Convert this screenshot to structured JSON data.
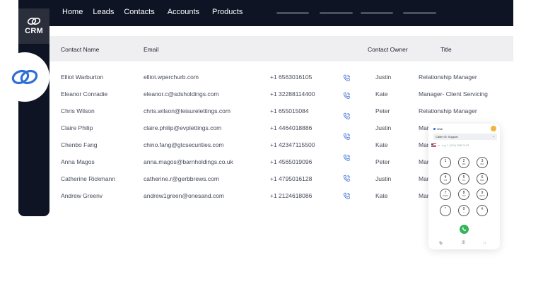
{
  "brand": {
    "label": "CRM"
  },
  "nav": {
    "items": [
      "Home",
      "Leads",
      "Contacts",
      "Accounts",
      "Products"
    ]
  },
  "table": {
    "headers": {
      "name": "Contact Name",
      "email": "Email",
      "owner": "Contact Owner",
      "title": "Title"
    },
    "rows": [
      {
        "name": "Elliot Warburton",
        "email": "elliot.wperchurb.com",
        "phone": "+1 6563016105",
        "owner": "Justin",
        "title": "Relationship Manager"
      },
      {
        "name": "Eleanor Conradie",
        "email": "eleanor.c@sdsholdings.com",
        "phone": "+1 32288114400",
        "owner": "Kate",
        "title": "Manager- Client Servicing"
      },
      {
        "name": "Chris Wilson",
        "email": "chris.wilson@leisurelettings.com",
        "phone": "+1 655015084",
        "owner": "Peter",
        "title": "Relationship Manager"
      },
      {
        "name": "Claire Philip",
        "email": "claire.philip@evplettings.com",
        "phone": "+1 4464018886",
        "owner": "Justin",
        "title": "Man"
      },
      {
        "name": "Chenbo Fang",
        "email": "chino.fang@gtcsecurities.com",
        "phone": "+1 42347115500",
        "owner": "Kate",
        "title": "Man"
      },
      {
        "name": "Anna Magos",
        "email": "anna.magos@barnholdings.co.uk",
        "phone": "+1 4565019096",
        "owner": "Peter",
        "title": "Man"
      },
      {
        "name": "Catherine Rickmann",
        "email": "catherine.r@gerbbrews.com",
        "phone": "+1 4795016128",
        "owner": "Justin",
        "title": "Man"
      },
      {
        "name": "Andrew Greenv",
        "email": "andrew1green@onesand.com",
        "phone": "+1 2124618086",
        "owner": "Kate",
        "title": "Man"
      }
    ]
  },
  "dialer": {
    "brand": "Web",
    "caller_id": "Caller ID: Support",
    "placeholder": "e.g. 1 (201) 555-0123",
    "keys": [
      {
        "num": "1",
        "letters": ""
      },
      {
        "num": "2",
        "letters": "ABC"
      },
      {
        "num": "3",
        "letters": "DEF"
      },
      {
        "num": "4",
        "letters": "GHI"
      },
      {
        "num": "5",
        "letters": "JKL"
      },
      {
        "num": "6",
        "letters": "MNO"
      },
      {
        "num": "7",
        "letters": "PQRS"
      },
      {
        "num": "8",
        "letters": "TUV"
      },
      {
        "num": "9",
        "letters": "WXYZ"
      },
      {
        "num": "*",
        "letters": ""
      },
      {
        "num": "0",
        "letters": "+"
      },
      {
        "num": "#",
        "letters": ""
      }
    ]
  },
  "colors": {
    "sidebar": "#0e1424",
    "header_bg": "#efeff1",
    "phone_icon": "#3f6fd8",
    "call_button": "#35b45a"
  },
  "icons": [
    "zoho-crm-logo-icon",
    "phone-call-icon",
    "history-icon",
    "dialpad-icon",
    "settings-icon"
  ]
}
